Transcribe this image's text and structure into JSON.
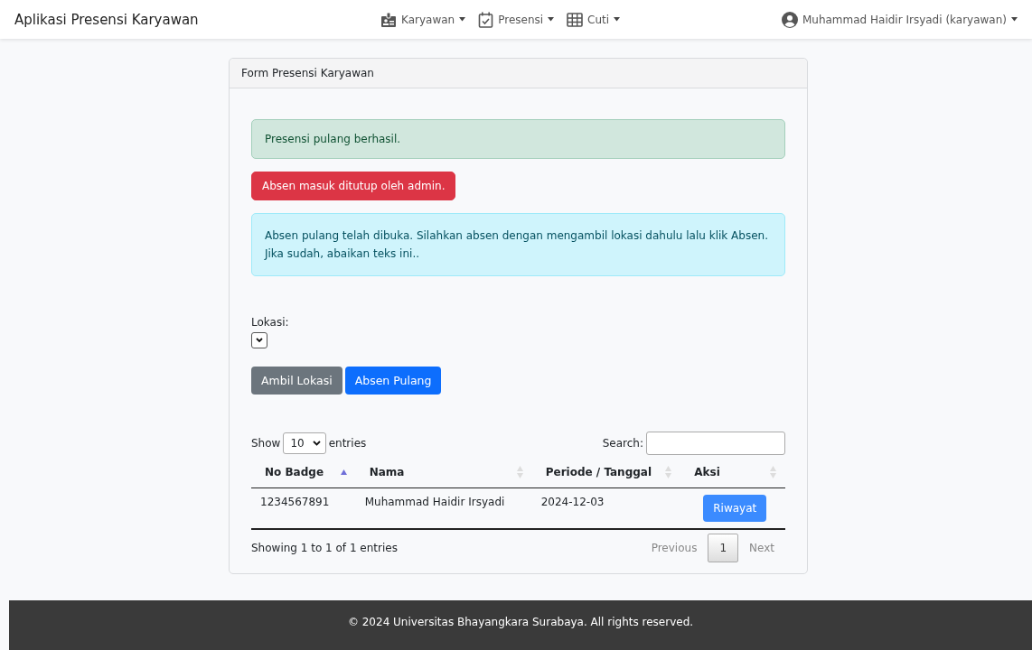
{
  "navbar": {
    "brand": "Aplikasi Presensi Karyawan",
    "menus": [
      {
        "label": "Karyawan"
      },
      {
        "label": "Presensi"
      },
      {
        "label": "Cuti"
      }
    ],
    "user": {
      "label": "Muhammad Haidir Irsyadi (karyawan)"
    }
  },
  "card": {
    "title": "Form Presensi Karyawan",
    "alerts": [
      {
        "kind": "success",
        "text": "Presensi pulang berhasil."
      },
      {
        "kind": "danger",
        "text": "Absen masuk ditutup oleh admin."
      },
      {
        "kind": "info",
        "text": "Absen pulang telah dibuka. Silahkan absen dengan mengambil lokasi dahulu lalu klik Absen. Jika sudah, abaikan teks ini.."
      }
    ],
    "location": {
      "label": "Lokasi:"
    },
    "buttons": [
      {
        "kind": "secondary",
        "label": "Ambil Lokasi"
      },
      {
        "kind": "primary",
        "label": "Absen Pulang"
      }
    ],
    "table": {
      "length": {
        "before": "Show",
        "value": "10",
        "after": "entries"
      },
      "search_label": "Search:",
      "columns": [
        {
          "label": "No Badge",
          "sorted": true
        },
        {
          "label": "Nama",
          "sorted": false
        },
        {
          "label": "Periode / Tanggal",
          "sorted": false
        },
        {
          "label": "Aksi",
          "sorted": false
        }
      ],
      "rows": [
        {
          "badge": "1234567891",
          "name": "Muhammad Haidir Irsyadi",
          "date": "2024-12-03",
          "action": "Riwayat"
        }
      ],
      "info": "Showing 1 to 1 of 1 entries",
      "pagination": {
        "previous": {
          "label": "Previous",
          "disabled": true
        },
        "pages": [
          {
            "label": "1",
            "selected": true
          }
        ],
        "next": {
          "label": "Next",
          "disabled": true
        }
      }
    }
  },
  "footer": {
    "text": "© 2024 Universitas Bhayangkara Surabaya. All rights reserved."
  }
}
